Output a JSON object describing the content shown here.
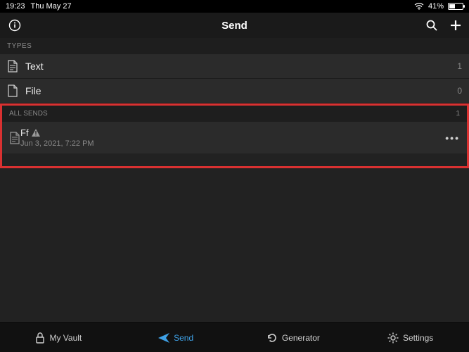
{
  "statusbar": {
    "time": "19:23",
    "date": "Thu May 27",
    "battery_pct": "41%"
  },
  "header": {
    "title": "Send"
  },
  "sections": {
    "types_label": "TYPES",
    "types": [
      {
        "label": "Text",
        "count": "1"
      },
      {
        "label": "File",
        "count": "0"
      }
    ],
    "all_sends_label": "ALL SENDS",
    "all_sends_count": "1",
    "sends": [
      {
        "name": "Ff",
        "date": "Jun 3, 2021, 7:22 PM"
      }
    ]
  },
  "tabs": {
    "vault": "My Vault",
    "send": "Send",
    "generator": "Generator",
    "settings": "Settings"
  }
}
